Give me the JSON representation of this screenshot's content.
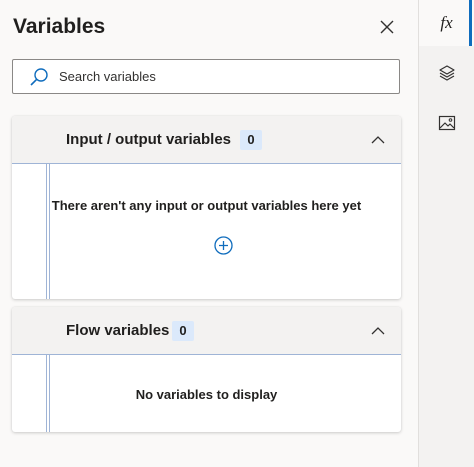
{
  "panel": {
    "title": "Variables",
    "search": {
      "placeholder": "Search variables",
      "value": ""
    }
  },
  "sections": [
    {
      "label": "Input / output variables",
      "count": "0",
      "empty_message": "There aren't any input or output variables here yet"
    },
    {
      "label": "Flow variables",
      "count": "0",
      "empty_message": "No variables to display"
    }
  ],
  "sidebar": {
    "items": [
      {
        "icon": "fx",
        "icon_name": "function-icon",
        "active": true
      },
      {
        "icon_name": "layers-icon",
        "active": false
      },
      {
        "icon_name": "image-icon",
        "active": false
      }
    ]
  },
  "colors": {
    "accent": "#0f6cbd",
    "badge_bg": "#dbe9fb",
    "rail": "#9fb4d6"
  }
}
